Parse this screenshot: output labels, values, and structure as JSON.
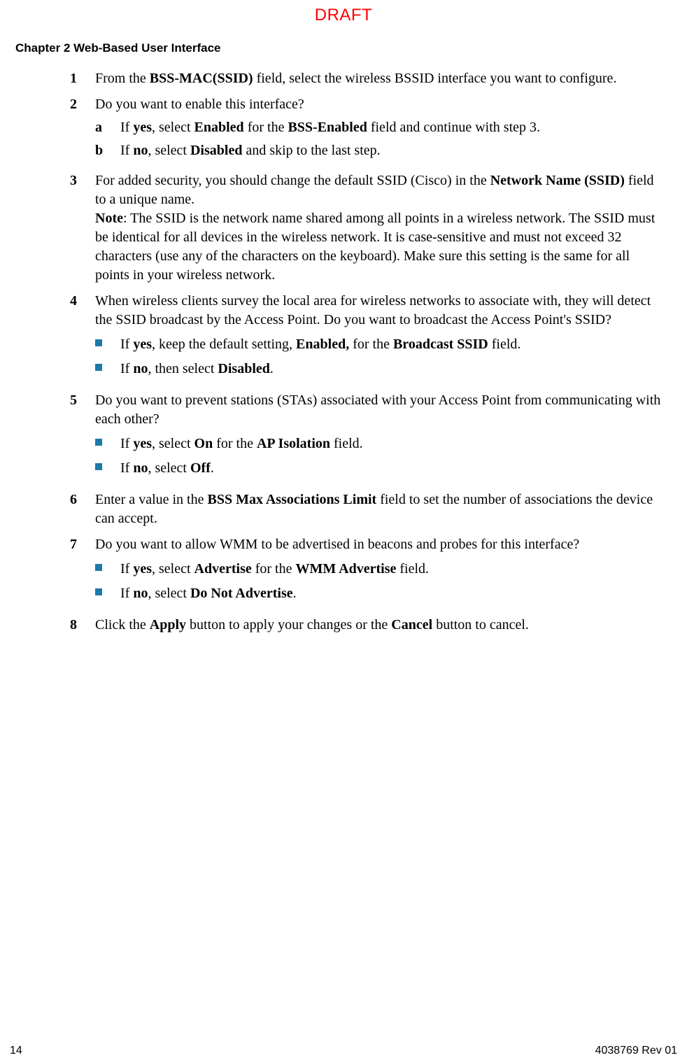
{
  "header": {
    "draft": "DRAFT",
    "chapter": "Chapter 2    Web-Based User Interface"
  },
  "steps": {
    "s1": {
      "num": "1"
    },
    "s2": {
      "num": "2",
      "q": "Do you want to enable this interface?"
    },
    "s2a": {
      "sub": "a"
    },
    "s2b": {
      "sub": "b"
    },
    "s3": {
      "num": "3"
    },
    "s4": {
      "num": "4",
      "q": "When wireless clients survey the local area for wireless networks to associate with, they will detect the SSID broadcast by the Access Point. Do you want to broadcast the Access Point's SSID?"
    },
    "s5": {
      "num": "5",
      "q": "Do you want to prevent stations (STAs) associated with your Access Point from communicating with each other?"
    },
    "s6": {
      "num": "6"
    },
    "s7": {
      "num": "7",
      "q": "Do you want to allow WMM to be advertised in beacons and probes for this interface?"
    },
    "s8": {
      "num": "8"
    }
  },
  "footer": {
    "page": "14",
    "rev": "4038769 Rev 01"
  }
}
